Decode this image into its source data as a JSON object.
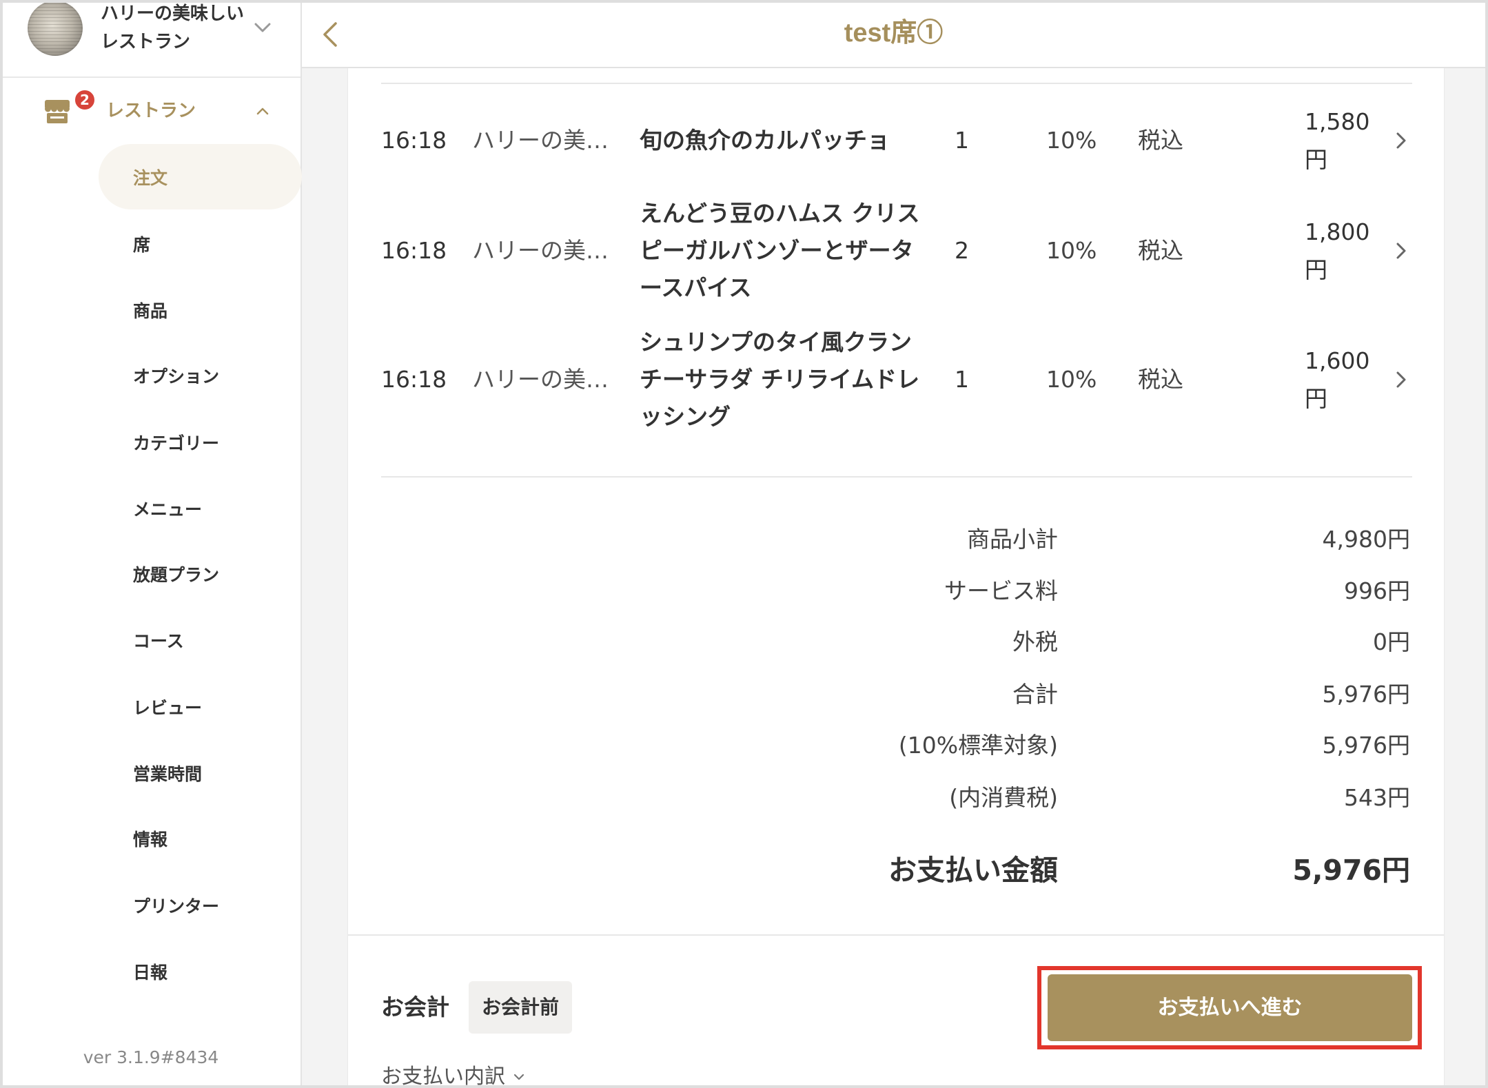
{
  "header": {
    "title": "test席①"
  },
  "sidebar": {
    "restaurant_name": "ハリーの美味しいレストラン",
    "nav_section": {
      "label": "レストラン",
      "badge": "2"
    },
    "items": [
      {
        "label": "注文",
        "active": true
      },
      {
        "label": "席",
        "active": false
      },
      {
        "label": "商品",
        "active": false
      },
      {
        "label": "オプション",
        "active": false
      },
      {
        "label": "カテゴリー",
        "active": false
      },
      {
        "label": "メニュー",
        "active": false
      },
      {
        "label": "放題プラン",
        "active": false
      },
      {
        "label": "コース",
        "active": false
      },
      {
        "label": "レビュー",
        "active": false
      },
      {
        "label": "営業時間",
        "active": false
      },
      {
        "label": "情報",
        "active": false
      },
      {
        "label": "プリンター",
        "active": false
      },
      {
        "label": "日報",
        "active": false
      }
    ],
    "version": "ver 3.1.9#8434"
  },
  "orders": [
    {
      "time": "16:18",
      "store": "ハリーの美…",
      "item": "旬の魚介のカルパッチョ",
      "quantity": "1",
      "tax_rate": "10%",
      "tax_type": "税込",
      "price": "1,580円"
    },
    {
      "time": "16:18",
      "store": "ハリーの美…",
      "item": "えんどう豆のハムス クリスピーガルバンゾーとザータースパイス",
      "quantity": "2",
      "tax_rate": "10%",
      "tax_type": "税込",
      "price": "1,800円"
    },
    {
      "time": "16:18",
      "store": "ハリーの美…",
      "item": "シュリンプのタイ風クランチーサラダ チリライムドレッシング",
      "quantity": "1",
      "tax_rate": "10%",
      "tax_type": "税込",
      "price": "1,600円"
    }
  ],
  "summary": [
    {
      "label": "商品小計",
      "value": "4,980円"
    },
    {
      "label": "サービス料",
      "value": "996円"
    },
    {
      "label": "外税",
      "value": "0円"
    },
    {
      "label": "合計",
      "value": "5,976円"
    },
    {
      "label": "(10%標準対象)",
      "value": "5,976円"
    },
    {
      "label": "(内消費税)",
      "value": "543円"
    }
  ],
  "total": {
    "label": "お支払い金額",
    "value": "5,976円"
  },
  "footer": {
    "checkout_label": "お会計",
    "status_badge": "お会計前",
    "pay_button": "お支払いへ進む",
    "breakdown_toggle": "お支払い内訳"
  },
  "icons": {
    "account_switcher": "chevron-down-icon",
    "nav_section": "store-icon",
    "nav_collapse": "chevron-up-icon",
    "back": "chevron-left-icon",
    "row_detail": "chevron-right-icon",
    "breakdown_toggle": "chevron-down-icon"
  },
  "colors": {
    "accent": "#a8915e",
    "active_background": "#f8f5ef",
    "badge": "#d7443a",
    "highlight": "#e2362c",
    "text": "#333333",
    "page_background": "#f3f3f3"
  }
}
